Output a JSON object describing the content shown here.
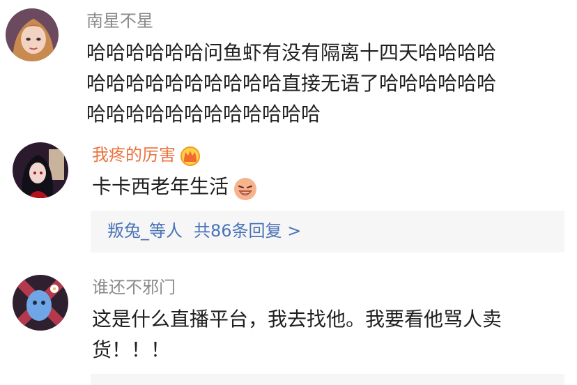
{
  "comments": [
    {
      "username": "南星不星",
      "lines": [
        "哈哈哈哈哈哈问鱼虾有没有隔离十四天哈哈哈哈",
        "哈哈哈哈哈哈哈哈哈哈直接无语了哈哈哈哈哈哈",
        "哈哈哈哈哈哈哈哈哈哈哈哈"
      ]
    },
    {
      "username": "我疼的厉害",
      "badge": "crown-badge-icon",
      "text": "卡卡西老年生活",
      "emoji": "laughing-emoji-icon",
      "replies": {
        "users": "叛兔_等人",
        "count_label": "共86条回复",
        "arrow": ">"
      }
    },
    {
      "username": "谁还不邪门",
      "lines": [
        "这是什么直播平台，我去找他。我要看他骂人卖",
        "货！！！"
      ]
    }
  ],
  "colors": {
    "vip_name": "#eb7340",
    "name": "#8a8a8a",
    "link": "#4a74b8",
    "reply_bg": "#f6f6f6"
  }
}
